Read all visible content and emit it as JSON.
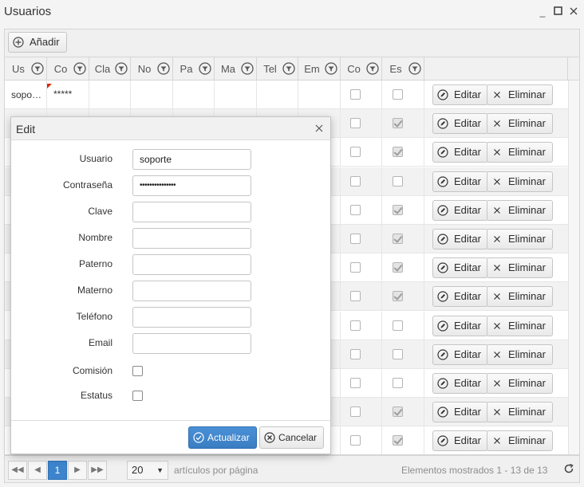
{
  "window": {
    "title": "Usuarios",
    "controls": {
      "minimize": "_",
      "maximize": "□",
      "close": "×"
    }
  },
  "toolbar": {
    "add_label": "Añadir"
  },
  "grid": {
    "columns": [
      "Us",
      "Co",
      "Cla",
      "No",
      "Pa",
      "Ma",
      "Tel",
      "Em",
      "Co",
      "Es"
    ],
    "rows": [
      {
        "usuario": "sopo…",
        "contrasena": "*****",
        "comision": false,
        "estatus": false,
        "dirty": true
      },
      {
        "comision": false,
        "estatus": true
      },
      {
        "comision": false,
        "estatus": true
      },
      {
        "comision": false,
        "estatus": false
      },
      {
        "comision": false,
        "estatus": true
      },
      {
        "comision": false,
        "estatus": true
      },
      {
        "comision": false,
        "estatus": true
      },
      {
        "comision": false,
        "estatus": true
      },
      {
        "comision": false,
        "estatus": false
      },
      {
        "comision": false,
        "estatus": false
      },
      {
        "comision": false,
        "estatus": false
      },
      {
        "comision": false,
        "estatus": true
      },
      {
        "comision": false,
        "estatus": true
      }
    ],
    "edit_label": "Editar",
    "delete_label": "Eliminar"
  },
  "pager": {
    "current_page": "1",
    "page_size": "20",
    "page_size_label": "artículos por página",
    "info": "Elementos mostrados 1 - 13 de 13"
  },
  "dialog": {
    "title": "Edit",
    "fields": [
      {
        "label": "Usuario",
        "value": "soporte",
        "type": "text"
      },
      {
        "label": "Contraseña",
        "value": "•••••••••••••••",
        "type": "password"
      },
      {
        "label": "Clave",
        "value": "",
        "type": "text"
      },
      {
        "label": "Nombre",
        "value": "",
        "type": "text"
      },
      {
        "label": "Paterno",
        "value": "",
        "type": "text"
      },
      {
        "label": "Materno",
        "value": "",
        "type": "text"
      },
      {
        "label": "Teléfono",
        "value": "",
        "type": "text"
      },
      {
        "label": "Email",
        "value": "",
        "type": "text"
      }
    ],
    "checkboxes": [
      {
        "label": "Comisión",
        "checked": false
      },
      {
        "label": "Estatus",
        "checked": false
      }
    ],
    "update_label": "Actualizar",
    "cancel_label": "Cancelar"
  },
  "colors": {
    "accent": "#3d84cc",
    "dirty_marker": "#d92800"
  }
}
